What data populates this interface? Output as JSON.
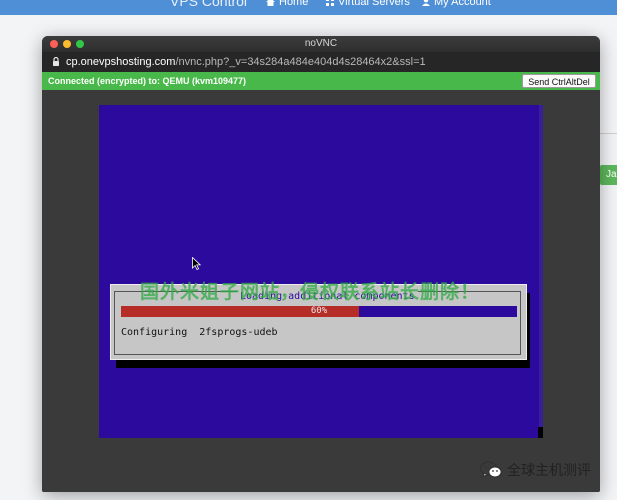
{
  "background_page": {
    "brand": "VPS Control",
    "nav": [
      {
        "label": "Home",
        "icon": "home-icon"
      },
      {
        "label": "Virtual Servers",
        "icon": "grid-icon"
      },
      {
        "label": "My Account",
        "icon": "user-icon"
      }
    ],
    "right_button_label": "Ja"
  },
  "window": {
    "title": "noVNC",
    "url_host": "cp.onevpshosting.com",
    "url_path": "/nvnc.php?_v=34s284a484e404d4s28464x2&ssl=1",
    "connection_status": "Connected (encrypted) to: QEMU (kvm109477)",
    "send_cad_label": "Send CtrlAltDel"
  },
  "console": {
    "dialog_title": "Loading additional components",
    "progress_label": "60%",
    "progress_value": 0.6,
    "configuring_text": "Configuring  2fsprogs-udeb"
  },
  "overlay": {
    "watermark": "国外米姐子网站，侵权联系站长删除！",
    "wechat_label": "全球主机测评"
  },
  "colors": {
    "console_bg": "#2d0a9e",
    "progress_fill": "#b62d27",
    "status_green": "#49b84a",
    "topnav_blue": "#4f8fd6"
  }
}
